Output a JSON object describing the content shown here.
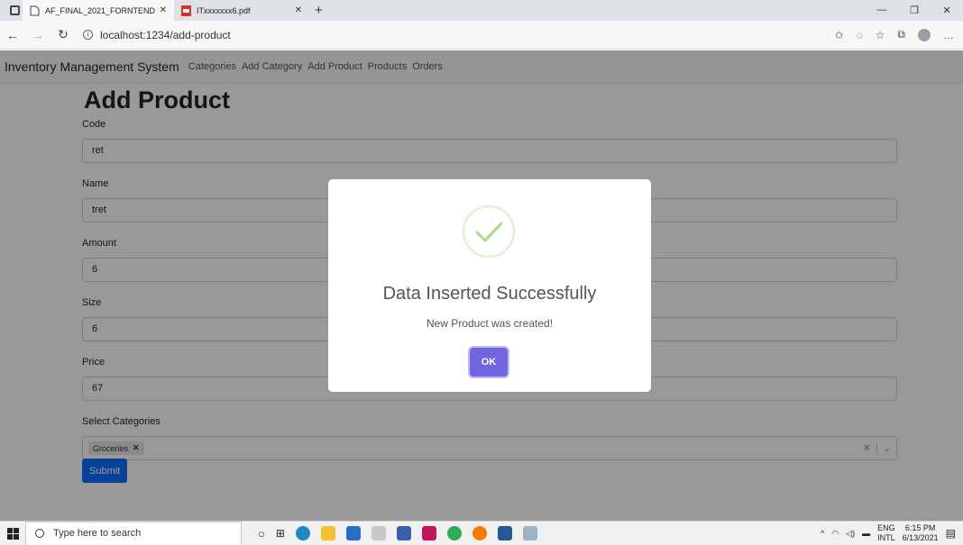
{
  "browser": {
    "tabs": [
      {
        "title": "AF_FINAL_2021_FORNTEND",
        "active": true
      },
      {
        "title": "ITxxxxxxx6.pdf",
        "active": false
      }
    ],
    "new_tab": "+",
    "url": "localhost:1234/add-product"
  },
  "navbar": {
    "brand": "Inventory Management System",
    "links": [
      "Categories",
      "Add Category",
      "Add Product",
      "Products",
      "Orders"
    ]
  },
  "form": {
    "heading": "Add Product",
    "fields": [
      {
        "label": "Code",
        "value": "ret"
      },
      {
        "label": "Name",
        "value": "tret"
      },
      {
        "label": "Amount",
        "value": "6"
      },
      {
        "label": "Size",
        "value": "6"
      },
      {
        "label": "Price",
        "value": "67"
      }
    ],
    "categories_label": "Select Categories",
    "selected_categories": [
      "Groceries"
    ],
    "submit_label": "Submit"
  },
  "modal": {
    "title": "Data Inserted Successfully",
    "text": "New Product was created!",
    "ok_label": "OK",
    "accent": "#7066e0",
    "success_color": "#a5dc86"
  },
  "taskbar": {
    "search_placeholder": "Type here to search",
    "lang_top": "ENG",
    "lang_bottom": "INTL",
    "time": "6:15 PM",
    "date": "6/13/2021"
  }
}
